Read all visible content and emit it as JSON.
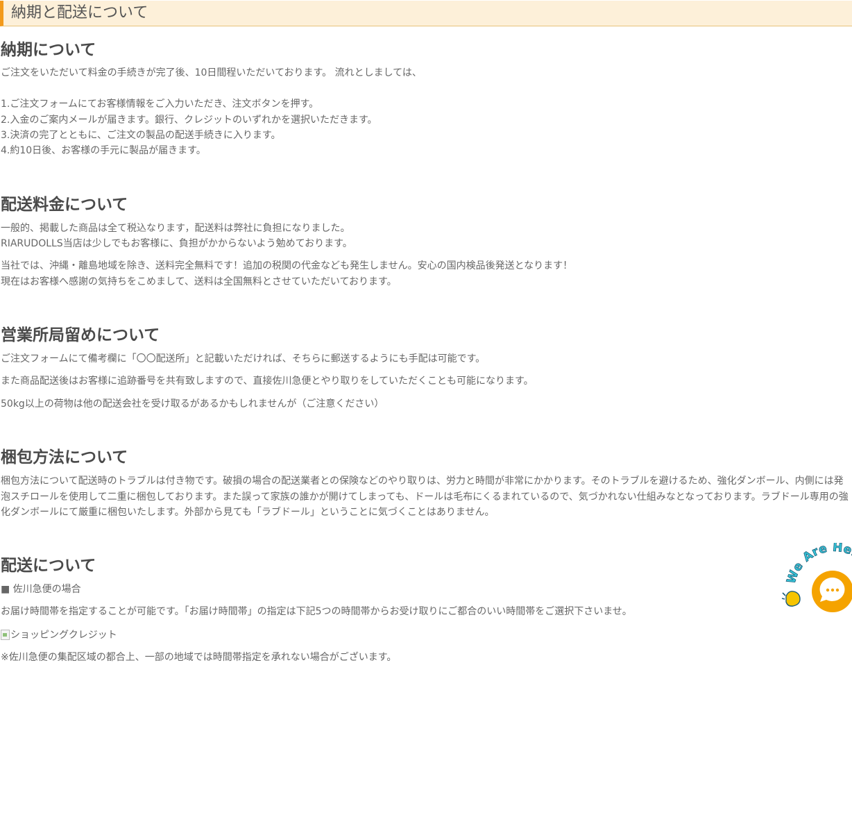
{
  "header": {
    "title": "納期と配送について"
  },
  "sections": {
    "delivery": {
      "heading": "納期について",
      "intro": "ご注文をいただいて料金の手続きが完了後、10日間程いただいております。 流れとしましては、",
      "steps": [
        "1.ご注文フォームにてお客様情報をご入力いただき、注文ボタンを押す。",
        "2.入金のご案内メールが届きます。銀行、クレジットのいずれかを選択いただきます。",
        "3.決済の完了とともに、ご注文の製品の配送手続きに入ります。",
        "4.約10日後、お客様の手元に製品が届きます。"
      ]
    },
    "fee": {
      "heading": "配送料金について",
      "lines": [
        "一般的、掲載した商品は全て税込なります，配送料は弊社に負担になりました。",
        "RIARUDOLLS当店は少しでもお客様に、負担がかからないよう勉めております。",
        "当社では、沖縄・離島地域を除き、送料完全無料です！追加の税関の代金なども発生しません。安心の国内検品後発送となります！",
        "現在はお客様へ感謝の気持ちをこめまして、送料は全国無料とさせていただいております。"
      ]
    },
    "pickup": {
      "heading": "営業所局留めについて",
      "lines": [
        "ご注文フォームにて備考欄に「〇〇配送所」と記載いただければ、そちらに郵送するようにも手配は可能です。",
        "また商品配送後はお客様に追跡番号を共有致しますので、直接佐川急便とやり取りをしていただくことも可能になります。",
        "50kg以上の荷物は他の配送会社を受け取るがあるかもしれませんが（ご注意ください）"
      ]
    },
    "packing": {
      "heading": "梱包方法について",
      "text": "梱包方法について配送時のトラブルは付き物です。破損の場合の配送業者との保険などのやり取りは、労力と時間が非常にかかります。そのトラブルを避けるため、強化ダンボール、内側には発泡スチロールを使用して二重に梱包しております。また誤って家族の誰かが開けてしまっても、ドールは毛布にくるまれているので、気づかれない仕組みなとなっております。ラブドール専用の強化ダンボールにて厳重に梱包いたします。外部から見ても「ラブドール」ということに気づくことはありません。"
    },
    "shipping": {
      "heading": "配送について",
      "carrier": "■ 佐川急便の場合",
      "time_note": "お届け時間帯を指定することが可能です。「お届け時間帯」の指定は下記5つの時間帯からお受け取りにご都合のいい時間帯をご選択下さいませ。",
      "image_alt": "ショッピングクレジット",
      "footnote": "※佐川急便の集配区域の都合上、一部の地域では時間帯指定を承れない場合がございます。"
    }
  },
  "chat_widget": {
    "badge_text": "We Are Here!",
    "icon": "chat-bubble-icon",
    "wave_icon": "waving-hand-icon",
    "accent_color": "#f5a300",
    "badge_color": "#36c4d8"
  },
  "colors": {
    "header_bg": "#fdf0d9",
    "header_accent": "#f39a1b",
    "heading_text": "#4a4a4a",
    "body_text": "#666666"
  }
}
